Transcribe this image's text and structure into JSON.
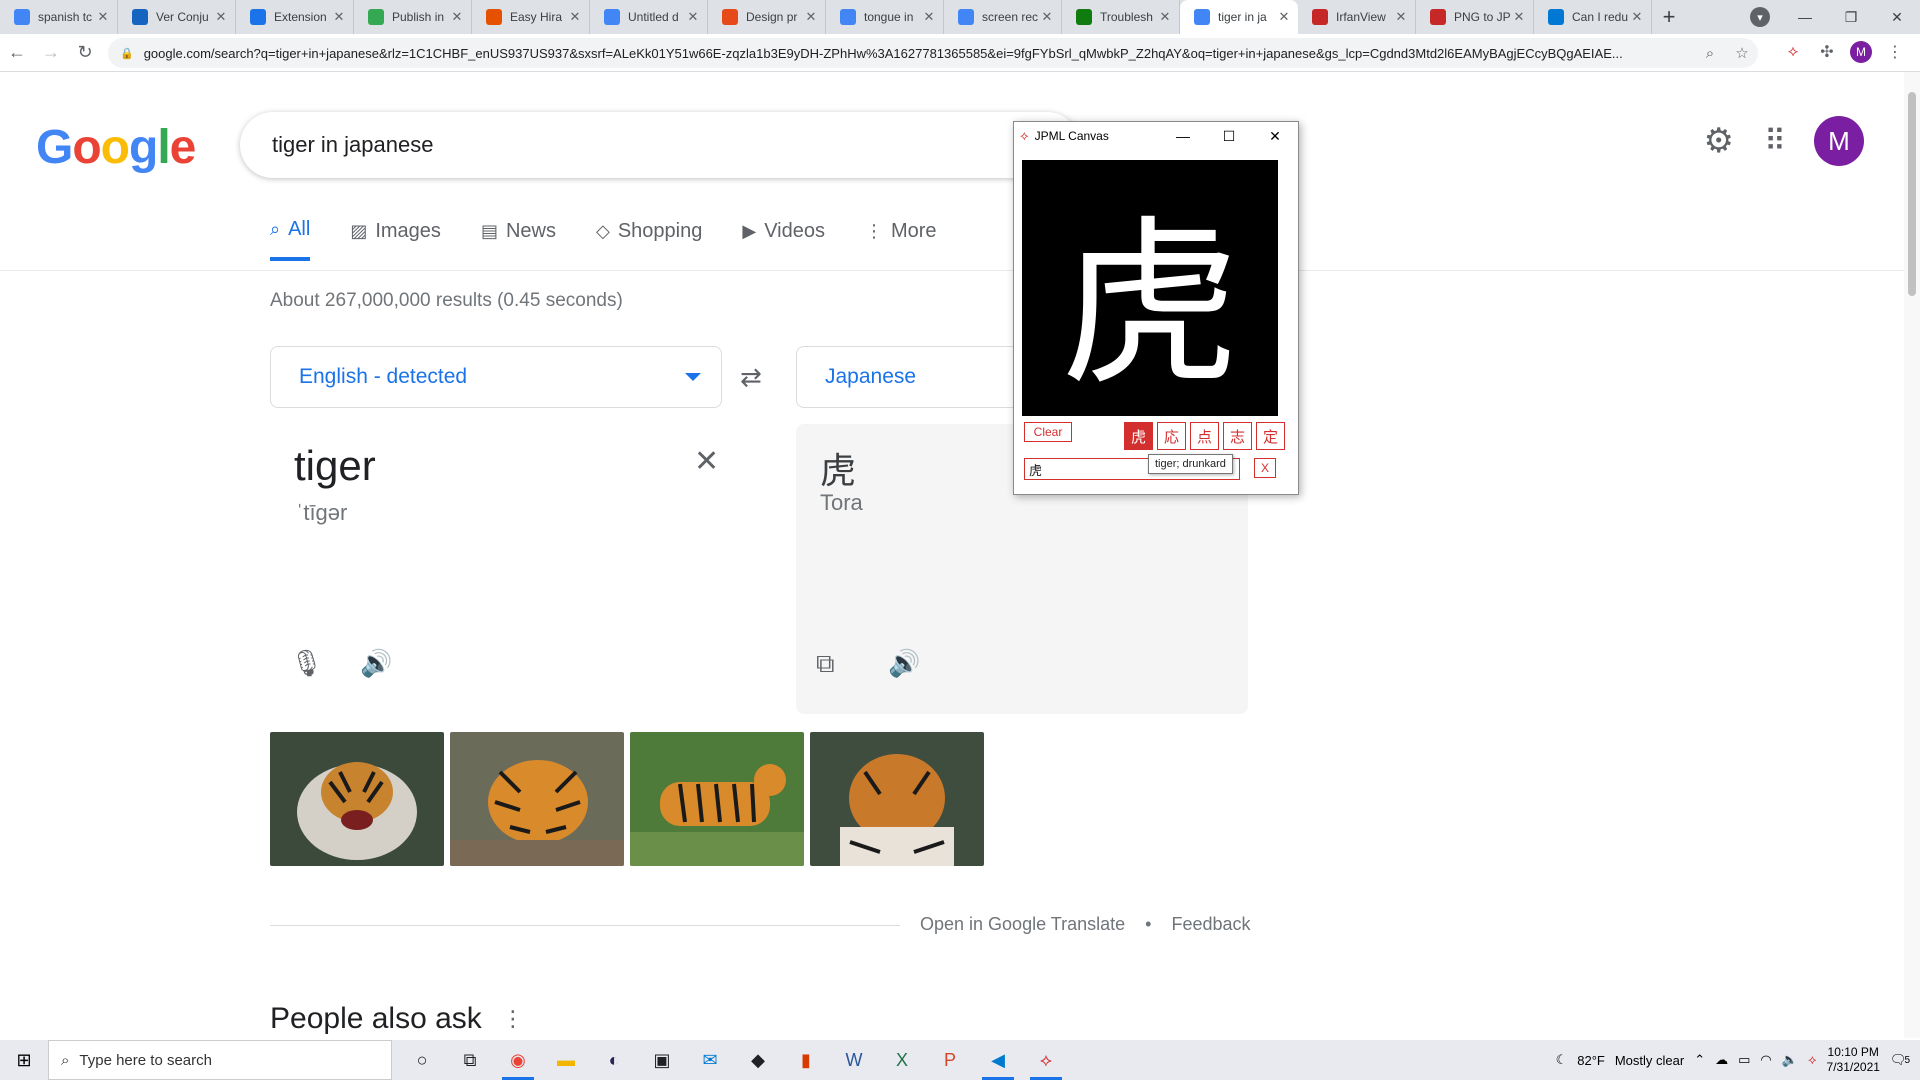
{
  "browser": {
    "tabs": [
      {
        "title": "spanish tc",
        "icon": "google-icon",
        "color": "#4285f4"
      },
      {
        "title": "Ver Conju",
        "icon": "app-icon",
        "color": "#1565c0"
      },
      {
        "title": "Extension",
        "icon": "puzzle-icon",
        "color": "#1a73e8"
      },
      {
        "title": "Publish in",
        "icon": "chrome-icon",
        "color": "#34a853"
      },
      {
        "title": "Easy Hira",
        "icon": "easy-icon",
        "color": "#e65100"
      },
      {
        "title": "Untitled d",
        "icon": "docs-icon",
        "color": "#4285f4"
      },
      {
        "title": "Design pr",
        "icon": "design-icon",
        "color": "#e64a19"
      },
      {
        "title": "tongue in",
        "icon": "google-icon",
        "color": "#4285f4"
      },
      {
        "title": "screen rec",
        "icon": "google-icon",
        "color": "#4285f4"
      },
      {
        "title": "Troublesh",
        "icon": "xbox-icon",
        "color": "#107c10"
      },
      {
        "title": "tiger in ja",
        "icon": "google-icon",
        "color": "#4285f4",
        "active": true
      },
      {
        "title": "IrfanView",
        "icon": "irfan-icon",
        "color": "#c62828"
      },
      {
        "title": "PNG to JP",
        "icon": "png-icon",
        "color": "#c62828"
      },
      {
        "title": "Can I redu",
        "icon": "windows-icon",
        "color": "#0078d4"
      }
    ],
    "url": "google.com/search?q=tiger+in+japanese&rlz=1C1CHBF_enUS937US937&sxsrf=ALeKk01Y51w66E-zqzla1b3E9yDH-ZPhHw%3A1627781365585&ei=9fgFYbSrl_qMwbkP_Z2hqAY&oq=tiger+in+japanese&gs_lcp=Cgdnd3Mtd2l6EAMyBAgjECcyBQgAEIAE...",
    "profile_initial": "M"
  },
  "google": {
    "logo": [
      "G",
      "o",
      "o",
      "g",
      "l",
      "e"
    ],
    "logo_colors": [
      "#4285f4",
      "#ea4335",
      "#fbbc05",
      "#4285f4",
      "#34a853",
      "#ea4335"
    ],
    "query": "tiger in japanese",
    "avatar_initial": "M",
    "nav_tabs": [
      {
        "label": "All",
        "icon": "search-icon"
      },
      {
        "label": "Images",
        "icon": "image-icon"
      },
      {
        "label": "News",
        "icon": "news-icon"
      },
      {
        "label": "Shopping",
        "icon": "tag-icon"
      },
      {
        "label": "Videos",
        "icon": "play-icon"
      },
      {
        "label": "More",
        "icon": "more-icon"
      }
    ],
    "results_stats": "About 267,000,000 results (0.45 seconds)"
  },
  "translate": {
    "source_lang": "English - detected",
    "target_lang": "Japanese",
    "source_text": "tiger",
    "source_phonetic": "ˈtīɡər",
    "target_text": "虎",
    "target_romaji": "Tora",
    "footer_open": "Open in Google Translate",
    "footer_sep": "•",
    "footer_feedback": "Feedback"
  },
  "people_also_ask": "People also ask",
  "jpml": {
    "title": "JPML Canvas",
    "canvas_char": "虎",
    "clear_label": "Clear",
    "candidates": [
      "虎",
      "応",
      "点",
      "志",
      "定"
    ],
    "input_value": "虎",
    "x_label": "X",
    "tooltip": "tiger; drunkard"
  },
  "taskbar": {
    "search_placeholder": "Type here to search",
    "weather_temp": "82°F",
    "weather_desc": "Mostly clear",
    "time": "10:10 PM",
    "date": "7/31/2021",
    "notif_count": "5"
  }
}
